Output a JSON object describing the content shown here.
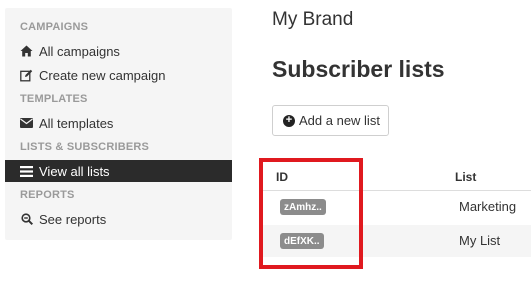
{
  "sidebar": {
    "campaigns_heading": "CAMPAIGNS",
    "all_campaigns": "All campaigns",
    "create_campaign": "Create new campaign",
    "templates_heading": "TEMPLATES",
    "all_templates": "All templates",
    "lists_heading": "LISTS & SUBSCRIBERS",
    "view_all_lists": "View all lists",
    "reports_heading": "REPORTS",
    "see_reports": "See reports",
    "icons": [
      "home-icon",
      "edit-icon",
      "envelope-icon",
      "list-icon",
      "search-report-icon"
    ]
  },
  "main": {
    "brand": "My Brand",
    "title": "Subscriber lists",
    "add_button": "Add a new list"
  },
  "table": {
    "headers": {
      "id": "ID",
      "list": "List"
    },
    "rows": [
      {
        "id": "zAmhz..",
        "name": "Marketing"
      },
      {
        "id": "dEfXK..",
        "name": "My List"
      }
    ]
  },
  "colors": {
    "active_item_bg": "#2b2b2b",
    "highlight": "#e0191f",
    "badge_bg": "#8c8c8c"
  }
}
